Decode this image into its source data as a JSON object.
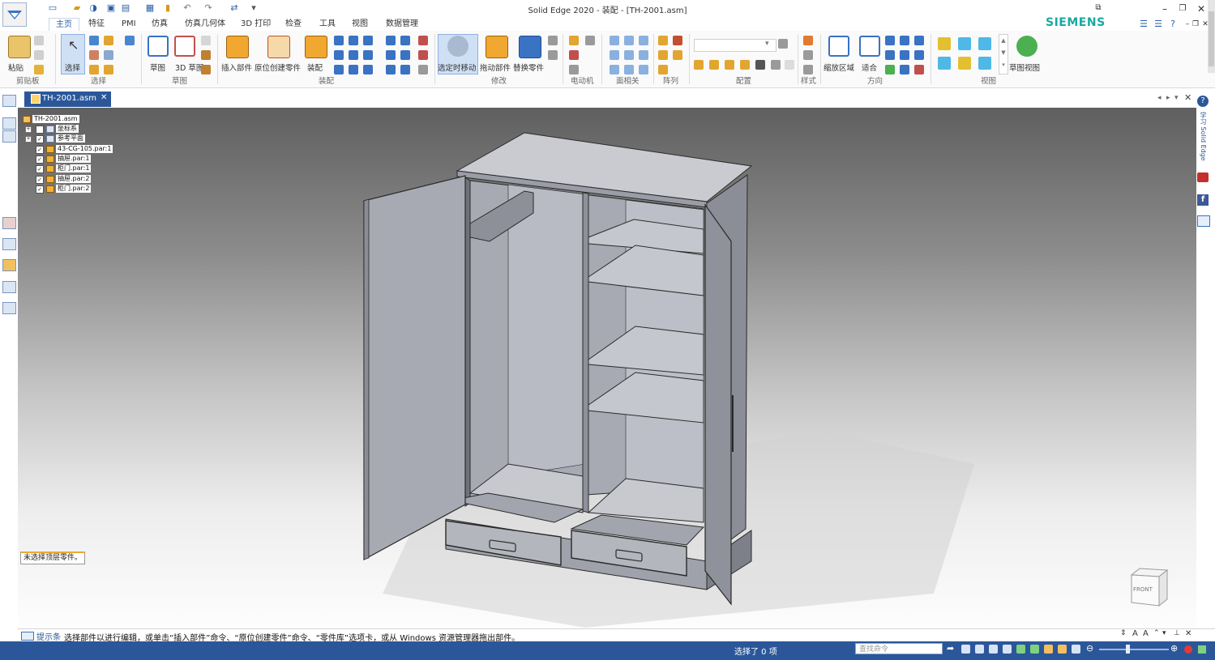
{
  "window": {
    "title": "Solid Edge 2020 - 装配 - [TH-2001.asm]",
    "brand": "SIEMENS"
  },
  "ribbon_tabs": [
    {
      "label": "主页",
      "active": true
    },
    {
      "label": "特征"
    },
    {
      "label": "PMI"
    },
    {
      "label": "仿真"
    },
    {
      "label": "仿真几何体"
    },
    {
      "label": "3D 打印"
    },
    {
      "label": "检查"
    },
    {
      "label": "工具"
    },
    {
      "label": "视图"
    },
    {
      "label": "数据管理"
    }
  ],
  "ribbon": {
    "paste": "粘贴",
    "select": "选择",
    "sketch": "草图",
    "sketch3d": "3D 草图",
    "insert_part": "插入部件",
    "create_in_place": "原位创建零件",
    "assemble": "装配",
    "move_when_selected": "选定时移动",
    "drag_component": "拖动部件",
    "replace_part": "替换零件",
    "zoom_area": "缩放区域",
    "fit": "适合",
    "sketch_view": "草图视图",
    "groups": {
      "clipboard": "剪贴板",
      "select": "选择",
      "sketch": "草图",
      "assemble": "装配",
      "modify": "修改",
      "motor": "电动机",
      "face_relate": "面相关",
      "pattern": "阵列",
      "configuration": "配置",
      "style": "样式",
      "orient": "方向",
      "views": "视图"
    }
  },
  "document_tab": "TH-2001.asm",
  "tree": {
    "root": "TH-2001.asm",
    "items": [
      {
        "label": "坐标系",
        "checked": false
      },
      {
        "label": "参考平面",
        "checked": true
      },
      {
        "label": "43-CG-105.par:1",
        "checked": true
      },
      {
        "label": "抽屉.par:1",
        "checked": true
      },
      {
        "label": "柜门.par:1",
        "checked": true
      },
      {
        "label": "抽屉.par:2",
        "checked": true
      },
      {
        "label": "柜门.par:2",
        "checked": true
      }
    ]
  },
  "quickbar_note": "未选择顶层零件。",
  "view_cube": "FRONT",
  "right_strip": {
    "label": "学习 Solid Edge"
  },
  "prompt": {
    "label": "提示条",
    "text": "选择部件以进行编辑，或单击“插入部件”命令、“原位创建零件”命令、“零件库”选项卡，或从 Windows 资源管理器拖出部件。"
  },
  "status": {
    "selection": "选择了 0 项",
    "search_placeholder": "查找命令"
  },
  "colors": {
    "accent": "#2b579a",
    "brand": "#1aa8a0"
  }
}
